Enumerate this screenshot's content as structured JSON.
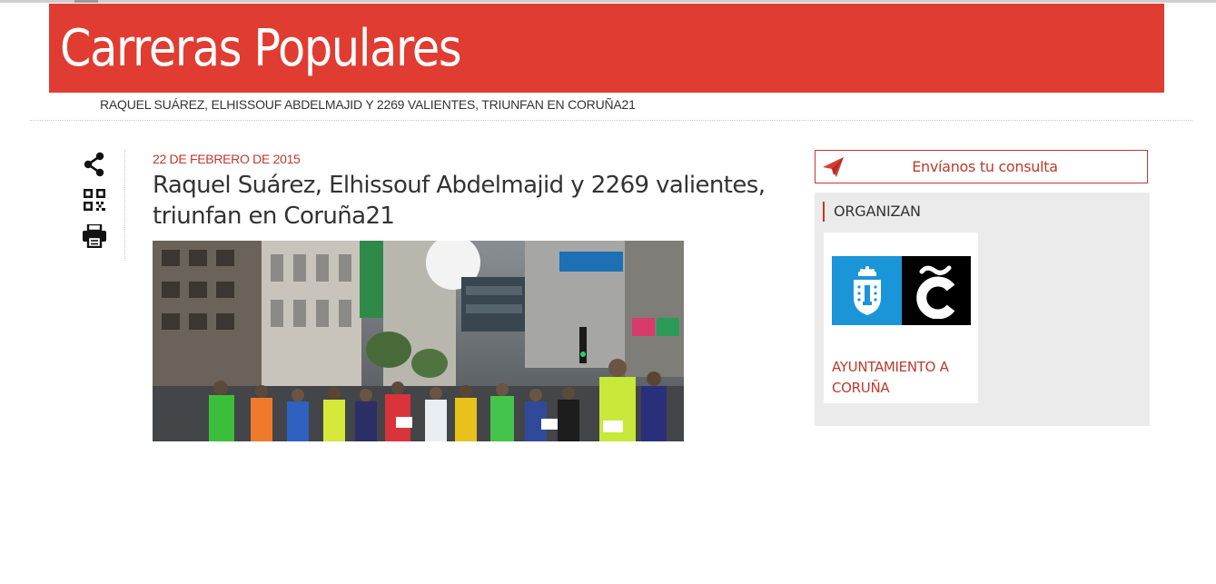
{
  "site": {
    "title": "Carreras Populares"
  },
  "breadcrumb": {
    "current": "RAQUEL SUÁREZ, ELHISSOUF ABDELMAJID Y 2269 VALIENTES, TRIUNFAN EN CORUÑA21"
  },
  "tools": {
    "icons": [
      "share-icon",
      "qr-code-icon",
      "print-icon"
    ]
  },
  "post": {
    "date": "22 DE FEBRERO DE 2015",
    "title": "Raquel Suárez, Elhissouf Abdelmajid y 2269 valientes, triunfan en Coruña21"
  },
  "sidebar": {
    "contact_label": "Envíanos tu consulta",
    "organizers_heading": "ORGANIZAN",
    "organizers": [
      {
        "name": "AYUNTAMIENTO A CORUÑA"
      }
    ]
  },
  "colors": {
    "brand": "#e03c31",
    "accent": "#c0392b",
    "panel": "#ebebeb",
    "logo_blue": "#1a95d8"
  }
}
